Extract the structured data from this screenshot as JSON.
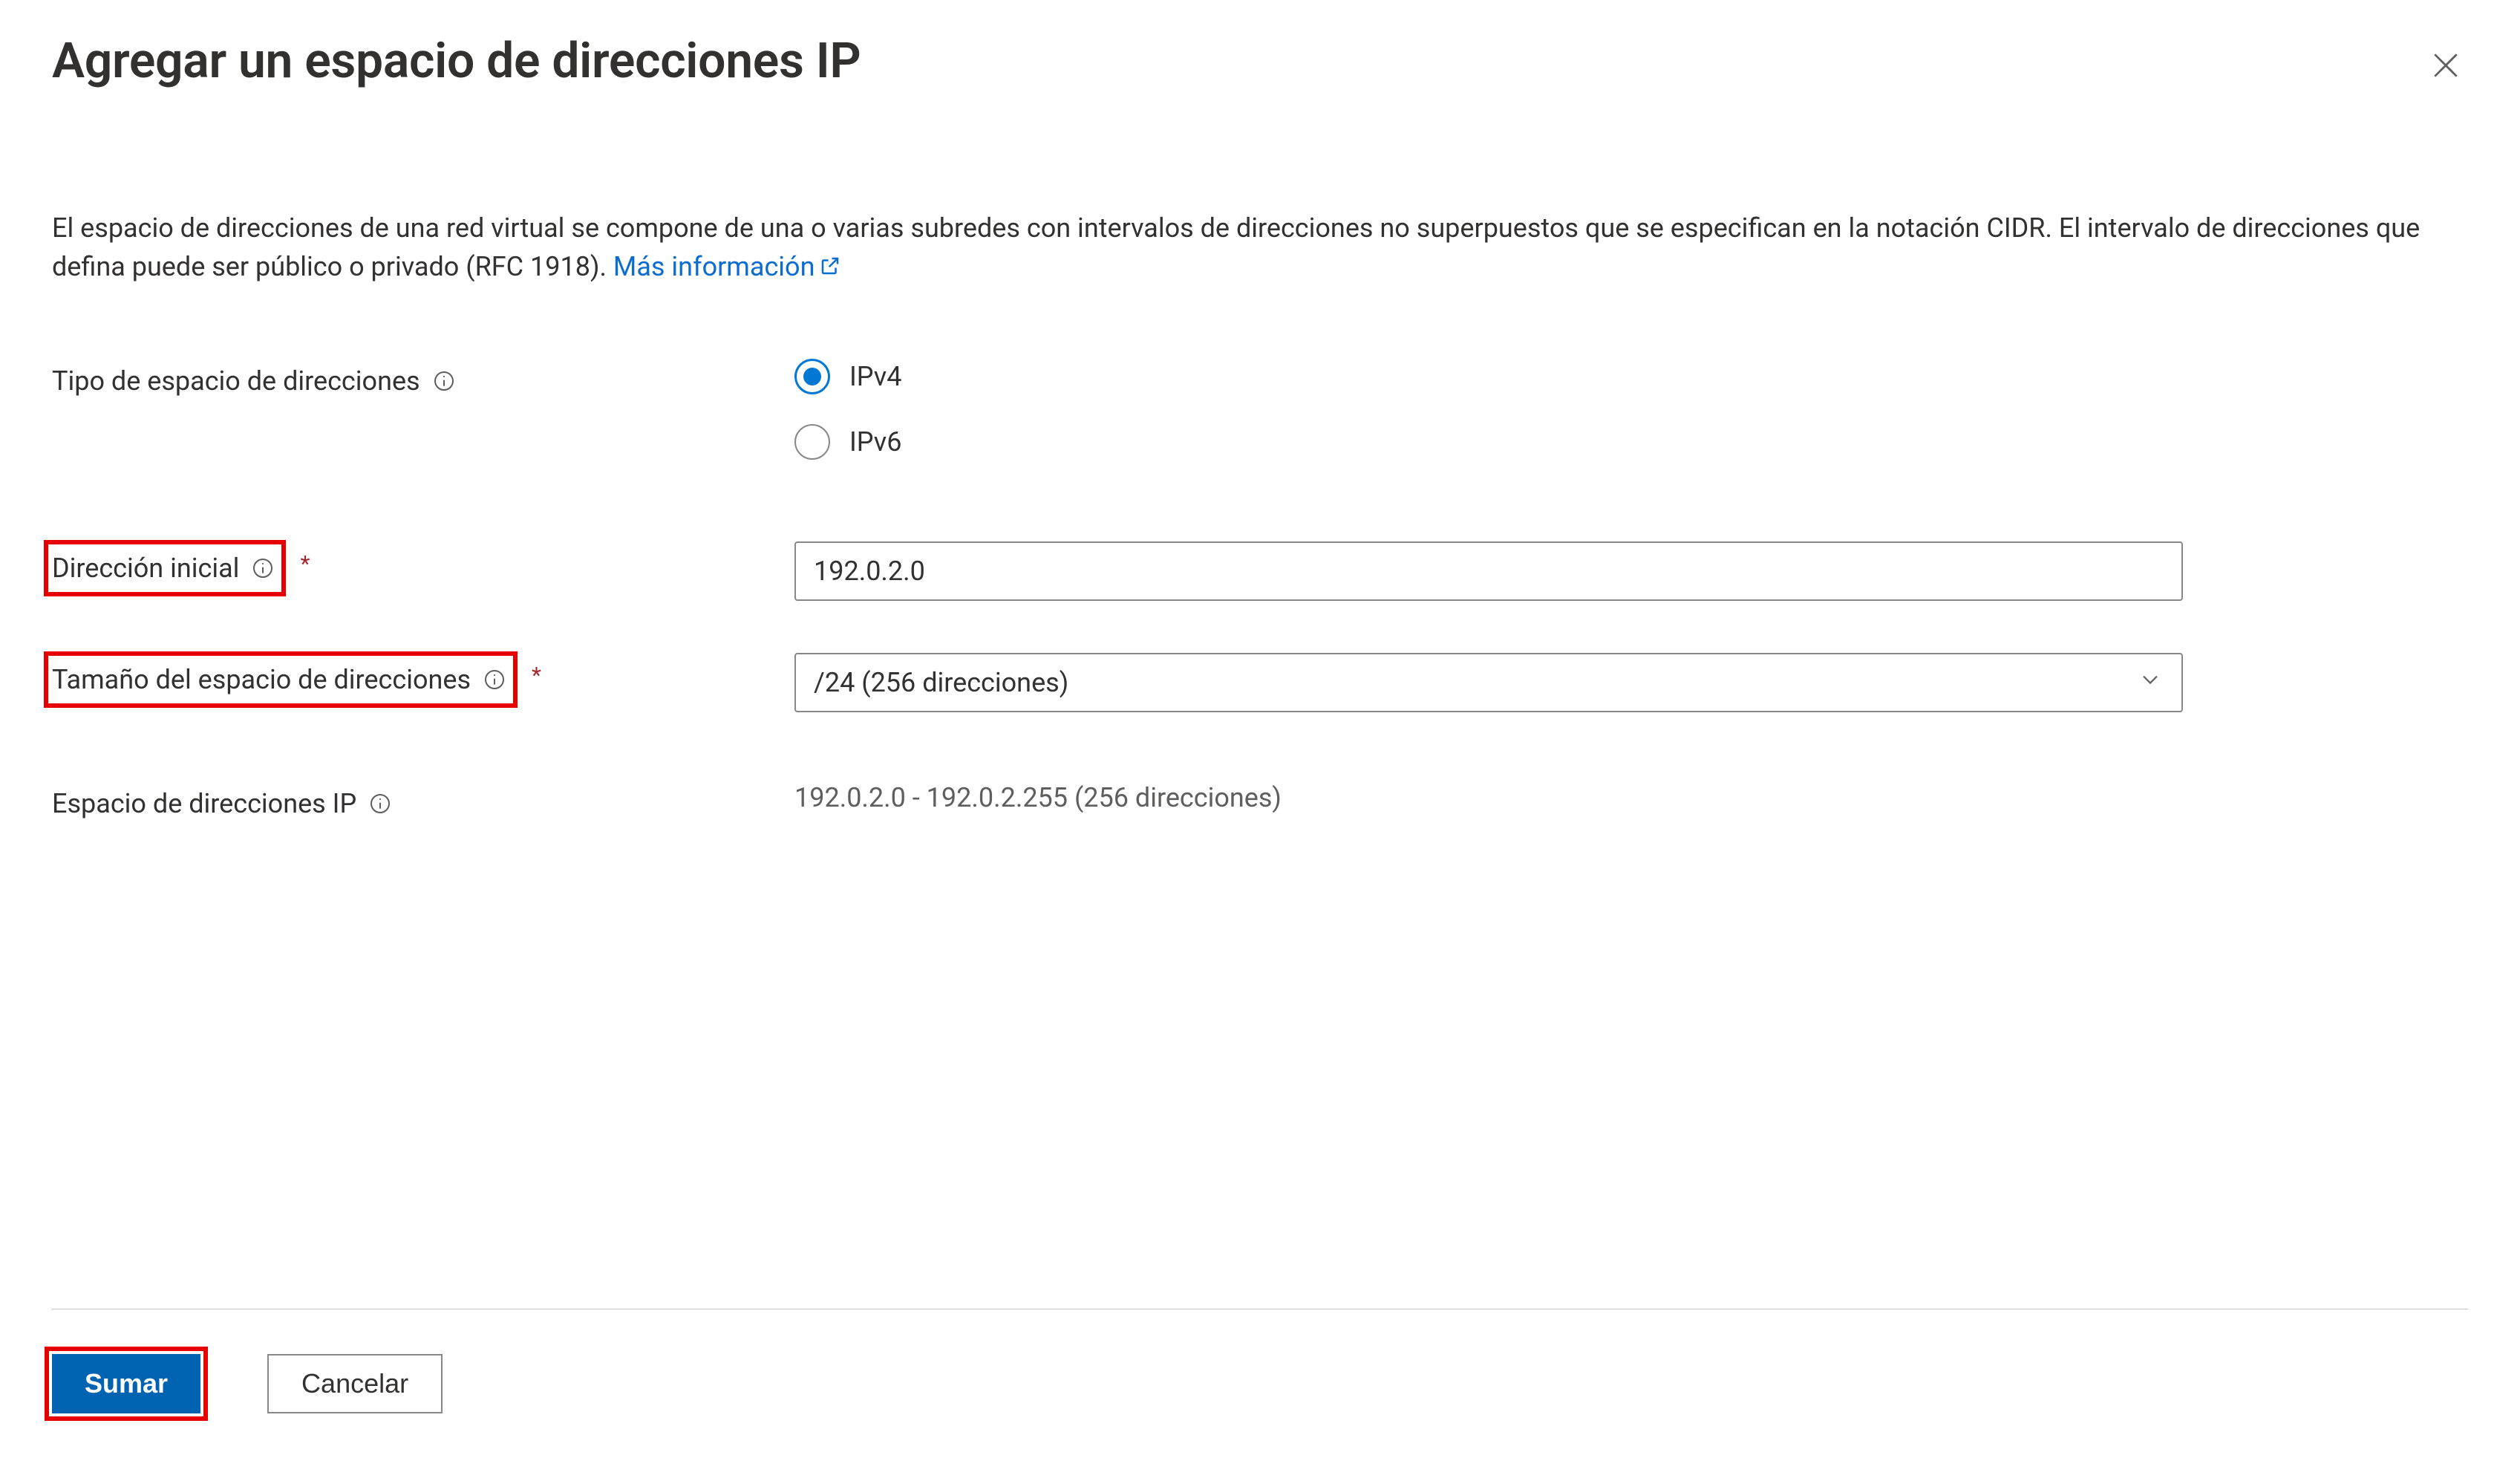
{
  "panel": {
    "title": "Agregar un espacio de direcciones IP",
    "description_pre": "El espacio de direcciones de una red virtual se compone de una o varias subredes con intervalos de direcciones no superpuestos que se especifican en la notación CIDR. El intervalo de direcciones que defina puede ser público o privado (RFC 1918). ",
    "learn_more": "Más información"
  },
  "fields": {
    "type": {
      "label": "Tipo de espacio de direcciones",
      "options": {
        "ipv4": "IPv4",
        "ipv6": "IPv6"
      },
      "selected": "ipv4"
    },
    "start_address": {
      "label": "Dirección inicial",
      "value": "192.0.2.0",
      "required": true
    },
    "size": {
      "label": "Tamaño del espacio de direcciones",
      "value_display": "/24 (256 direcciones)",
      "required": true
    },
    "ip_space": {
      "label": "Espacio de direcciones IP",
      "value": "192.0.2.0 - 192.0.2.255 (256 direcciones)"
    }
  },
  "footer": {
    "primary": "Sumar",
    "secondary": "Cancelar"
  }
}
